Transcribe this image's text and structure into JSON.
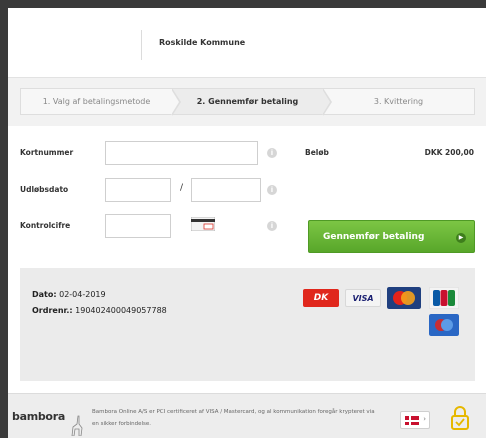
{
  "header": {
    "merchant": "Roskilde Kommune"
  },
  "steps": [
    {
      "label": "1. Valg af betalingsmetode"
    },
    {
      "label": "2. Gennemfør betaling"
    },
    {
      "label": "3. Kvittering"
    }
  ],
  "form": {
    "card_number_label": "Kortnummer",
    "expiry_label": "Udløbsdato",
    "expiry_separator": "/",
    "cvc_label": "Kontrolcifre",
    "info_glyph": "i"
  },
  "amount": {
    "label": "Beløb",
    "value": "DKK 200,00"
  },
  "pay_button": {
    "label": "Gennemfør betaling",
    "arrow": "▶"
  },
  "order": {
    "date_label": "Dato:",
    "date_value": "02-04-2019",
    "order_label": "Ordrenr.:",
    "order_value": "190402400049057788"
  },
  "card_logos": {
    "dankort": "DK",
    "visa": "VISA"
  },
  "footer": {
    "brand": "bambora",
    "text": "Bambora Online A/S er PCI certificeret af VISA / Mastercard, og al kommunikation foregår krypteret via en sikker forbindelse.",
    "lang_caret": "›"
  },
  "colors": {
    "accent_green": "#5fae30",
    "dankort_red": "#e0271c",
    "visa_blue": "#1a1f71"
  }
}
